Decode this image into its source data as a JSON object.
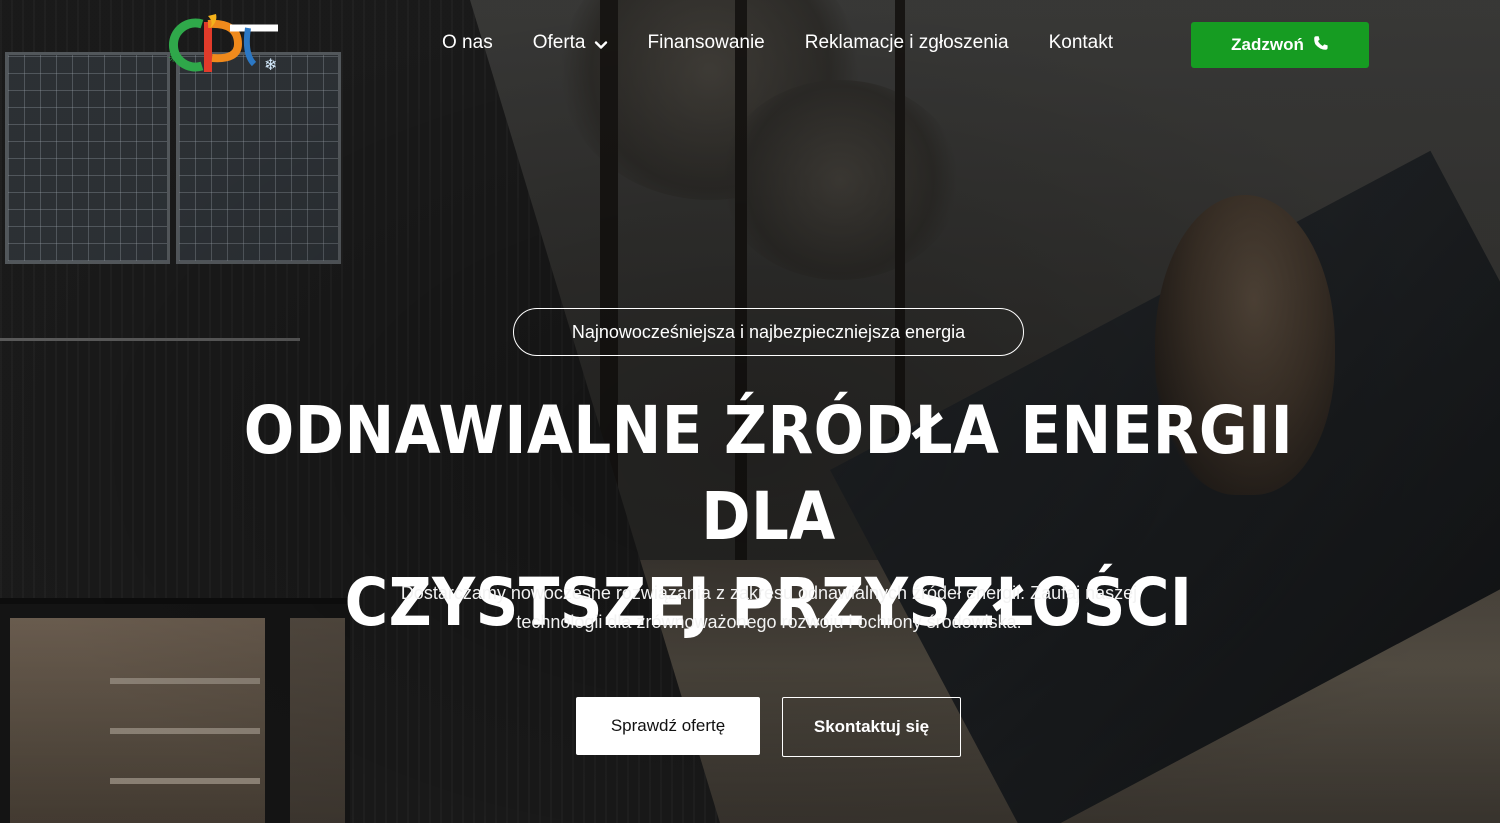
{
  "header": {
    "logo_icon": "company-logo",
    "nav": [
      {
        "label": "O nas"
      },
      {
        "label": "Oferta",
        "icon": "chevron-down-icon"
      },
      {
        "label": "Finansowanie"
      },
      {
        "label": "Reklamacje i zgłoszenia"
      },
      {
        "label": "Kontakt"
      }
    ],
    "call_button": {
      "label": "Zadzwoń",
      "icon": "phone-icon",
      "color": "#169c22"
    }
  },
  "hero": {
    "pill": "Najnowocześniejsza i najbezpieczniejsza energia",
    "headline_line1": "ODNAWIALNE ŹRÓDŁA ENERGII DLA",
    "headline_line2": "CZYSTSZEJ PRZYSZŁOŚCI",
    "description_line1": "Dostarczamy nowoczesne rozwiązania z zakresu odnawialnych źródeł energii. Zaufaj naszej",
    "description_line2": "technologii dla zrównoważonego rozwoju i ochrony środowiska.",
    "primary_button": "Sprawdź ofertę",
    "secondary_button": "Skontaktuj się"
  }
}
